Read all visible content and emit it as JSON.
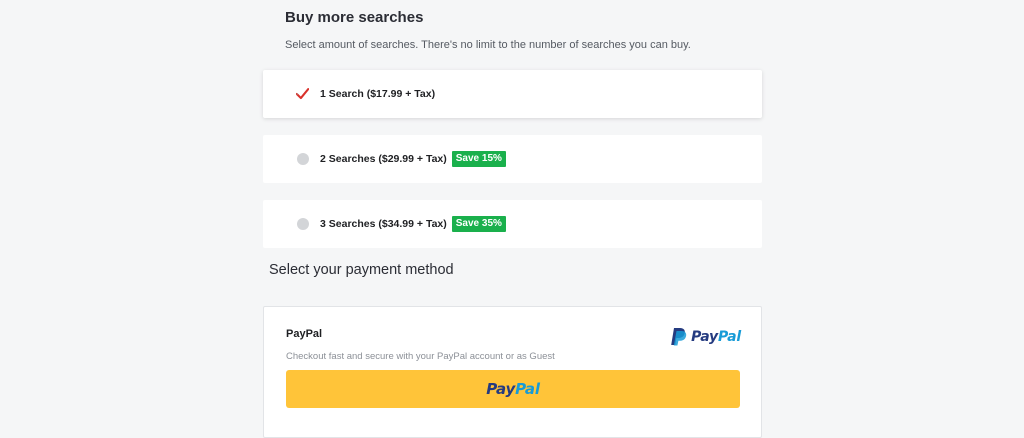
{
  "header": {
    "title": "Buy more searches",
    "subtitle": "Select amount of searches. There's no limit to the number of searches you can buy."
  },
  "options": [
    {
      "label": "1 Search ($17.99 + Tax)",
      "badge": "",
      "selected": true
    },
    {
      "label": "2 Searches ($29.99 + Tax)",
      "badge": "Save 15%",
      "selected": false
    },
    {
      "label": "3 Searches ($34.99 + Tax)",
      "badge": "Save 35%",
      "selected": false
    }
  ],
  "payment": {
    "section_title": "Select your payment method",
    "method_name": "PayPal",
    "description": "Checkout fast and secure with your PayPal account or as Guest",
    "logo_text_part1": "Pay",
    "logo_text_part2": "Pal",
    "button_text_part1": "Pay",
    "button_text_part2": "Pal"
  },
  "colors": {
    "accent_green": "#1ab04c",
    "check_red": "#d9312b",
    "paypal_yellow": "#ffc439",
    "paypal_dark_blue": "#253b80",
    "paypal_light_blue": "#179bd7"
  },
  "icons": {
    "selected": "checkmark-icon",
    "unselected": "radio-icon",
    "paypal": "paypal-logo-icon"
  }
}
